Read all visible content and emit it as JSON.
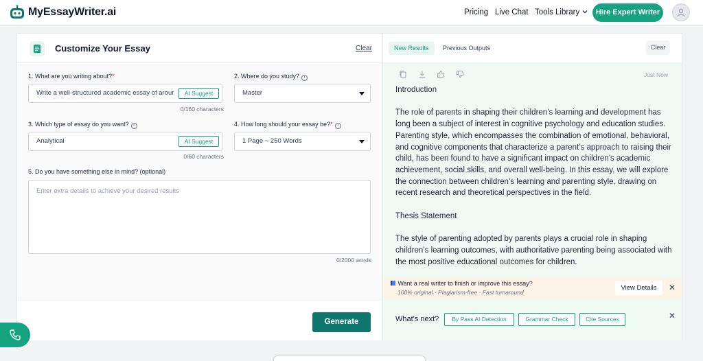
{
  "nav": {
    "brand": "MyEssayWriter.ai",
    "links": [
      "Pricing",
      "Live Chat",
      "Tools Library"
    ],
    "cta": "Hire Expert Writer"
  },
  "left": {
    "title": "Customize Your Essay",
    "clear": "Clear",
    "q1": {
      "label": "1. What are you writing about?",
      "value": "Write a well-structured academic essay of arour",
      "ai": "AI Suggest",
      "counter": "0/160 characters"
    },
    "q2": {
      "label": "2. Where do you study?",
      "value": "Master"
    },
    "q3": {
      "label": "3. Which type of essay do you want?",
      "value": "Analytical",
      "ai": "AI Suggest",
      "counter": "0/60 characters"
    },
    "q4": {
      "label": "4. How long should your essay be?",
      "value": "1 Page ~ 250 Words"
    },
    "q5": {
      "label": "5. Do you have something else in mind? (optional)",
      "placeholder": "Enter extra details to achieve your desired results",
      "counter": "0/2000 words"
    },
    "generate": "Generate"
  },
  "right": {
    "tabs": [
      "New Results",
      "Previous Outputs"
    ],
    "clear": "Clear",
    "timestamp": "Just Now",
    "essay": [
      "Introduction",
      "The role of parents in shaping their children’s learning and development has long been a subject of interest in cognitive psychology and education studies. Parenting style, which encompasses the combination of emotional, behavioral, and cognitive components that characterize a parent’s approach to raising their child, has been found to have a significant impact on children’s academic achievement, social skills, and overall well-being. In this essay, we will explore the connection between children’s learning and parenting style, drawing on recent research and theoretical perspectives in the field.",
      "Thesis Statement",
      "The style of parenting adopted by parents plays a crucial role in shaping children’s learning outcomes, with authoritative parenting being associated with the most positive educational outcomes for children."
    ],
    "banner": {
      "question": "Want a real writer to finish or improve this essay?",
      "sub": "100% original · Plagiarism-free · Fast turnaround",
      "button": "View Details"
    },
    "whats_next": {
      "label": "What's next?",
      "chips": [
        "By Pass AI Detection",
        "Grammar Check",
        "Cite Sources"
      ]
    }
  },
  "colors": {
    "accent": "#16a37f",
    "generate": "#0f766e",
    "result_bg": "#f0faf5",
    "banner_bg": "#fdf3e6"
  }
}
